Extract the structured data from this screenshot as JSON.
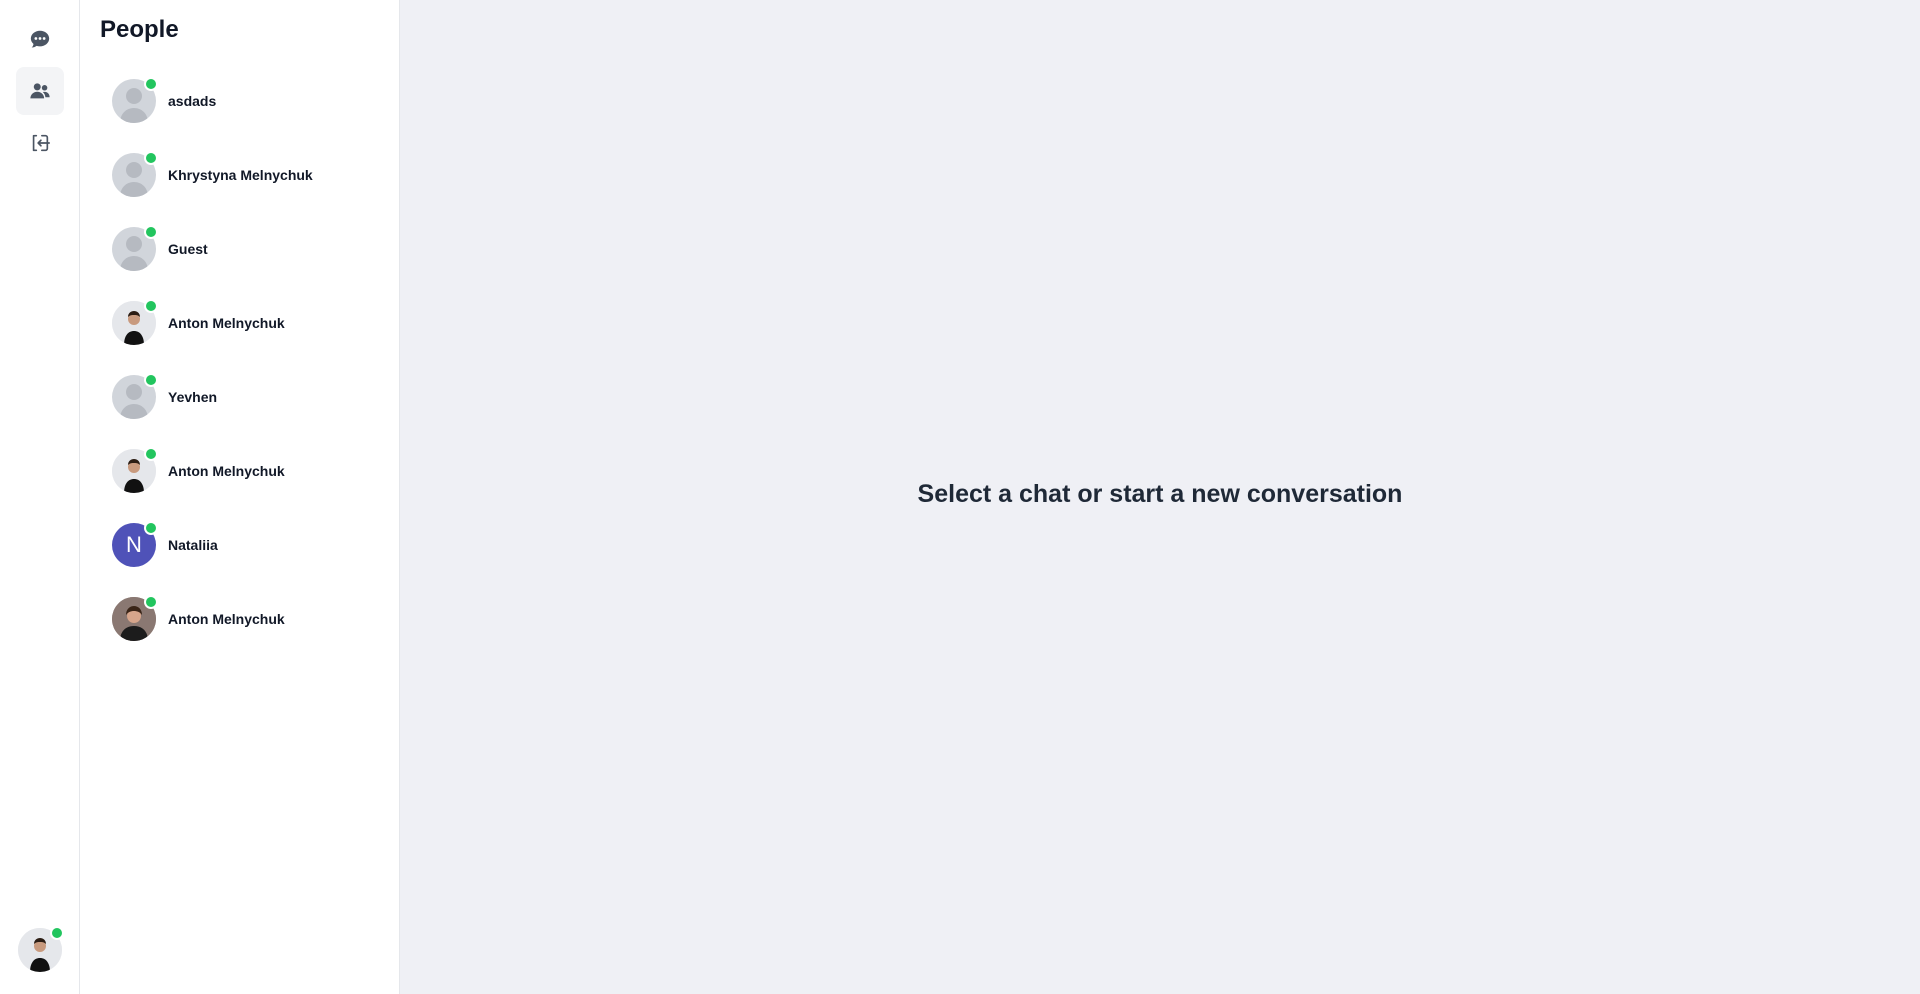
{
  "nav": {
    "items": [
      {
        "icon": "chat-bubble-icon",
        "active": false
      },
      {
        "icon": "users-icon",
        "active": true
      },
      {
        "icon": "logout-icon",
        "active": false
      }
    ],
    "current_user": {
      "avatar": "photo",
      "online": true
    }
  },
  "people": {
    "title": "People",
    "items": [
      {
        "name": "asdads",
        "avatar": "placeholder",
        "online": true
      },
      {
        "name": "Khrystyna Melnychuk",
        "avatar": "placeholder",
        "online": true
      },
      {
        "name": "Guest",
        "avatar": "placeholder",
        "online": true
      },
      {
        "name": "Anton Melnychuk",
        "avatar": "photo",
        "online": true
      },
      {
        "name": "Yevhen",
        "avatar": "placeholder",
        "online": true
      },
      {
        "name": "Anton Melnychuk",
        "avatar": "photo",
        "online": true
      },
      {
        "name": "Nataliia",
        "avatar": "initial",
        "initial": "N",
        "online": true
      },
      {
        "name": "Anton Melnychuk",
        "avatar": "photo",
        "online": true
      }
    ]
  },
  "main": {
    "empty_message": "Select a chat or start a new conversation"
  },
  "colors": {
    "online": "#22c55e",
    "main_background": "#eff0f5",
    "initial_avatar": "#4f52b8"
  }
}
